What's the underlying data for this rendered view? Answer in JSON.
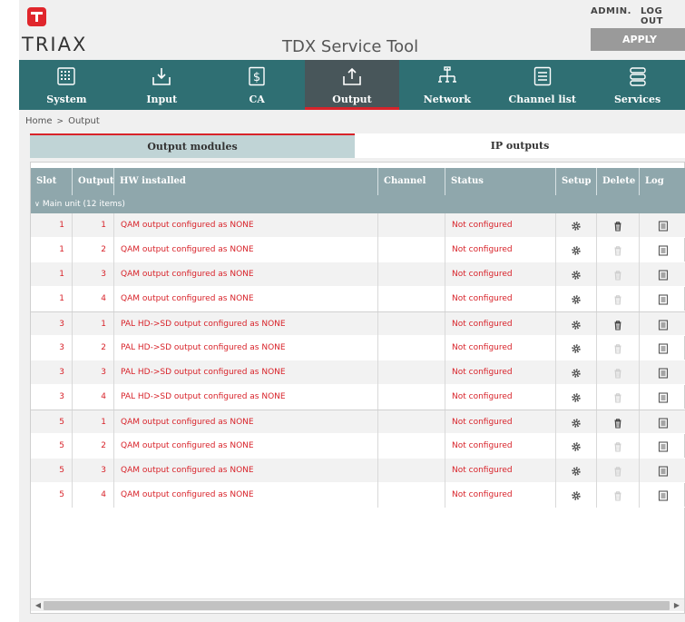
{
  "header": {
    "brand": "TRIAX",
    "app_title": "TDX Service Tool",
    "user_label": "ADMIN.",
    "logout_label": "LOG OUT",
    "apply_label": "APPLY"
  },
  "nav": {
    "items": [
      {
        "label": "System",
        "icon": "system-icon",
        "active": false
      },
      {
        "label": "Input",
        "icon": "input-icon",
        "active": false
      },
      {
        "label": "CA",
        "icon": "ca-icon",
        "active": false
      },
      {
        "label": "Output",
        "icon": "output-icon",
        "active": true
      },
      {
        "label": "Network",
        "icon": "network-icon",
        "active": false
      },
      {
        "label": "Channel list",
        "icon": "channel-list-icon",
        "active": false
      },
      {
        "label": "Services",
        "icon": "services-icon",
        "active": false
      }
    ]
  },
  "breadcrumb": {
    "home": "Home",
    "separator": ">",
    "current": "Output"
  },
  "subtabs": {
    "output_modules": "Output modules",
    "ip_outputs": "IP outputs"
  },
  "table": {
    "columns": {
      "slot": "Slot",
      "output": "Output",
      "hw": "HW installed",
      "channel": "Channel",
      "status": "Status",
      "setup": "Setup",
      "delete": "Delete",
      "log": "Log"
    },
    "group_label": "Main unit (12 items)",
    "rows": [
      {
        "slot": "1",
        "output": "1",
        "hw": "QAM output configured as NONE",
        "channel": "",
        "status": "Not configured",
        "delete_enabled": true
      },
      {
        "slot": "1",
        "output": "2",
        "hw": "QAM output configured as NONE",
        "channel": "",
        "status": "Not configured",
        "delete_enabled": false
      },
      {
        "slot": "1",
        "output": "3",
        "hw": "QAM output configured as NONE",
        "channel": "",
        "status": "Not configured",
        "delete_enabled": false
      },
      {
        "slot": "1",
        "output": "4",
        "hw": "QAM output configured as NONE",
        "channel": "",
        "status": "Not configured",
        "delete_enabled": false
      },
      {
        "slot": "3",
        "output": "1",
        "hw": "PAL HD->SD output configured as NONE",
        "channel": "",
        "status": "Not configured",
        "delete_enabled": true
      },
      {
        "slot": "3",
        "output": "2",
        "hw": "PAL HD->SD output configured as NONE",
        "channel": "",
        "status": "Not configured",
        "delete_enabled": false
      },
      {
        "slot": "3",
        "output": "3",
        "hw": "PAL HD->SD output configured as NONE",
        "channel": "",
        "status": "Not configured",
        "delete_enabled": false
      },
      {
        "slot": "3",
        "output": "4",
        "hw": "PAL HD->SD output configured as NONE",
        "channel": "",
        "status": "Not configured",
        "delete_enabled": false
      },
      {
        "slot": "5",
        "output": "1",
        "hw": "QAM output configured as NONE",
        "channel": "",
        "status": "Not configured",
        "delete_enabled": true
      },
      {
        "slot": "5",
        "output": "2",
        "hw": "QAM output configured as NONE",
        "channel": "",
        "status": "Not configured",
        "delete_enabled": false
      },
      {
        "slot": "5",
        "output": "3",
        "hw": "QAM output configured as NONE",
        "channel": "",
        "status": "Not configured",
        "delete_enabled": false
      },
      {
        "slot": "5",
        "output": "4",
        "hw": "QAM output configured as NONE",
        "channel": "",
        "status": "Not configured",
        "delete_enabled": false
      }
    ]
  },
  "colors": {
    "nav_bg": "#2f6f73",
    "nav_active_bg": "#48565a",
    "accent_red": "#d8232a",
    "table_header_bg": "#8fa7ac"
  }
}
